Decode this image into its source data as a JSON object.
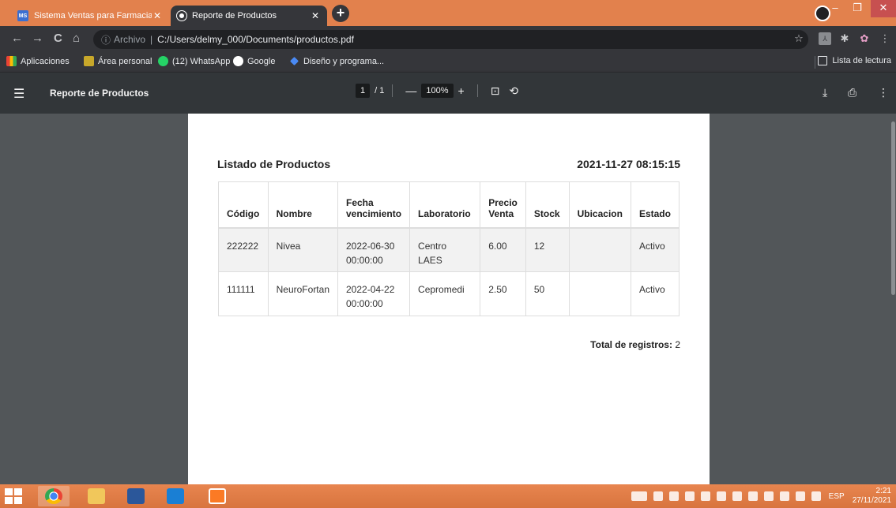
{
  "browser": {
    "tabs": [
      {
        "title": "Sistema Ventas para Farmacia - F",
        "favicon": "ms-favicon-icon"
      },
      {
        "title": "Reporte de Productos",
        "favicon": "globe-icon"
      }
    ],
    "address": {
      "scheme_label": "Archivo",
      "url": "C:/Users/delmy_000/Documents/productos.pdf"
    },
    "bookmarks": [
      {
        "label": "Aplicaciones",
        "color": "#4285f4"
      },
      {
        "label": "Área personal",
        "color": "#f4b400"
      },
      {
        "label": "(12) WhatsApp",
        "color": "#25d366"
      },
      {
        "label": "Google",
        "color": "#ffffff"
      },
      {
        "label": "Diseño y programa...",
        "color": "#4a8af4"
      }
    ],
    "reading_list": "Lista de lectura"
  },
  "pdf_viewer": {
    "title": "Reporte de Productos",
    "page_current": "1",
    "page_total": "/ 1",
    "zoom": "100%"
  },
  "document": {
    "heading": "Listado de Productos",
    "datetime": "2021-11-27 08:15:15",
    "columns": {
      "codigo": "Código",
      "nombre": "Nombre",
      "fecha_l1": "Fecha",
      "fecha_l2": "vencimiento",
      "laboratorio": "Laboratorio",
      "precio_l1": "Precio",
      "precio_l2": "Venta",
      "stock": "Stock",
      "ubicacion": "Ubicacion",
      "estado": "Estado"
    },
    "rows": [
      {
        "codigo": "222222",
        "nombre": "Nivea",
        "fecha_l1": "2022-06-30",
        "fecha_l2": "00:00:00",
        "lab_l1": "Centro",
        "lab_l2": "LAES",
        "precio": "6.00",
        "stock": "12",
        "ubicacion": "",
        "estado": "Activo"
      },
      {
        "codigo": "111111",
        "nombre": "NeuroFortan",
        "fecha_l1": "2022-04-22",
        "fecha_l2": "00:00:00",
        "lab_l1": "Cepromedi",
        "lab_l2": "",
        "precio": "2.50",
        "stock": "50",
        "ubicacion": "",
        "estado": "Activo"
      }
    ],
    "total_label": "Total de registros:",
    "total_value": "2"
  },
  "taskbar": {
    "language": "ESP",
    "time": "2:21",
    "date": "27/11/2021"
  }
}
